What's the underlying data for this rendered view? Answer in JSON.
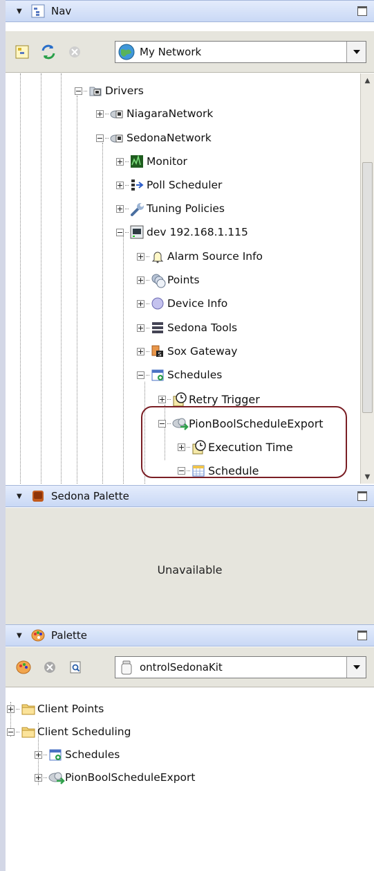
{
  "nav": {
    "title": "Nav",
    "combo_value": "My Network",
    "tree": [
      {
        "label": "Drivers",
        "icon": "folder-network-icon"
      },
      {
        "label": "NiagaraNetwork",
        "icon": "network-icon"
      },
      {
        "label": "SedonaNetwork",
        "icon": "network-icon"
      },
      {
        "label": "Monitor",
        "icon": "monitor-icon"
      },
      {
        "label": "Poll Scheduler",
        "icon": "poll-scheduler-icon"
      },
      {
        "label": "Tuning Policies",
        "icon": "wrench-icon"
      },
      {
        "label": "dev 192.168.1.115",
        "icon": "device-icon"
      },
      {
        "label": "Alarm Source Info",
        "icon": "bell-icon"
      },
      {
        "label": "Points",
        "icon": "points-icon"
      },
      {
        "label": "Device Info",
        "icon": "circle-icon"
      },
      {
        "label": "Sedona Tools",
        "icon": "stack-icon"
      },
      {
        "label": "Sox Gateway",
        "icon": "gateway-icon"
      },
      {
        "label": "Schedules",
        "icon": "calendar-icon"
      },
      {
        "label": "Retry Trigger",
        "icon": "trigger-clock-icon"
      },
      {
        "label": "PionBoolScheduleExport",
        "icon": "cloud-export-icon"
      },
      {
        "label": "Execution Time",
        "icon": "trigger-clock-icon"
      },
      {
        "label": "Schedule",
        "icon": "calendar-grid-icon"
      }
    ]
  },
  "sedona_palette": {
    "title": "Sedona Palette",
    "message": "Unavailable"
  },
  "palette": {
    "title": "Palette",
    "combo_value": "ontrolSedonaKit",
    "tree": [
      {
        "label": "Client Points",
        "icon": "folder-icon"
      },
      {
        "label": "Client Scheduling",
        "icon": "folder-icon"
      },
      {
        "label": "Schedules",
        "icon": "calendar-icon"
      },
      {
        "label": "PionBoolScheduleExport",
        "icon": "cloud-export-icon"
      }
    ]
  },
  "colors": {
    "header_bg": "#c9d8f5",
    "toolbar_bg": "#e6e5dd",
    "highlight_border": "#7a1e24"
  }
}
